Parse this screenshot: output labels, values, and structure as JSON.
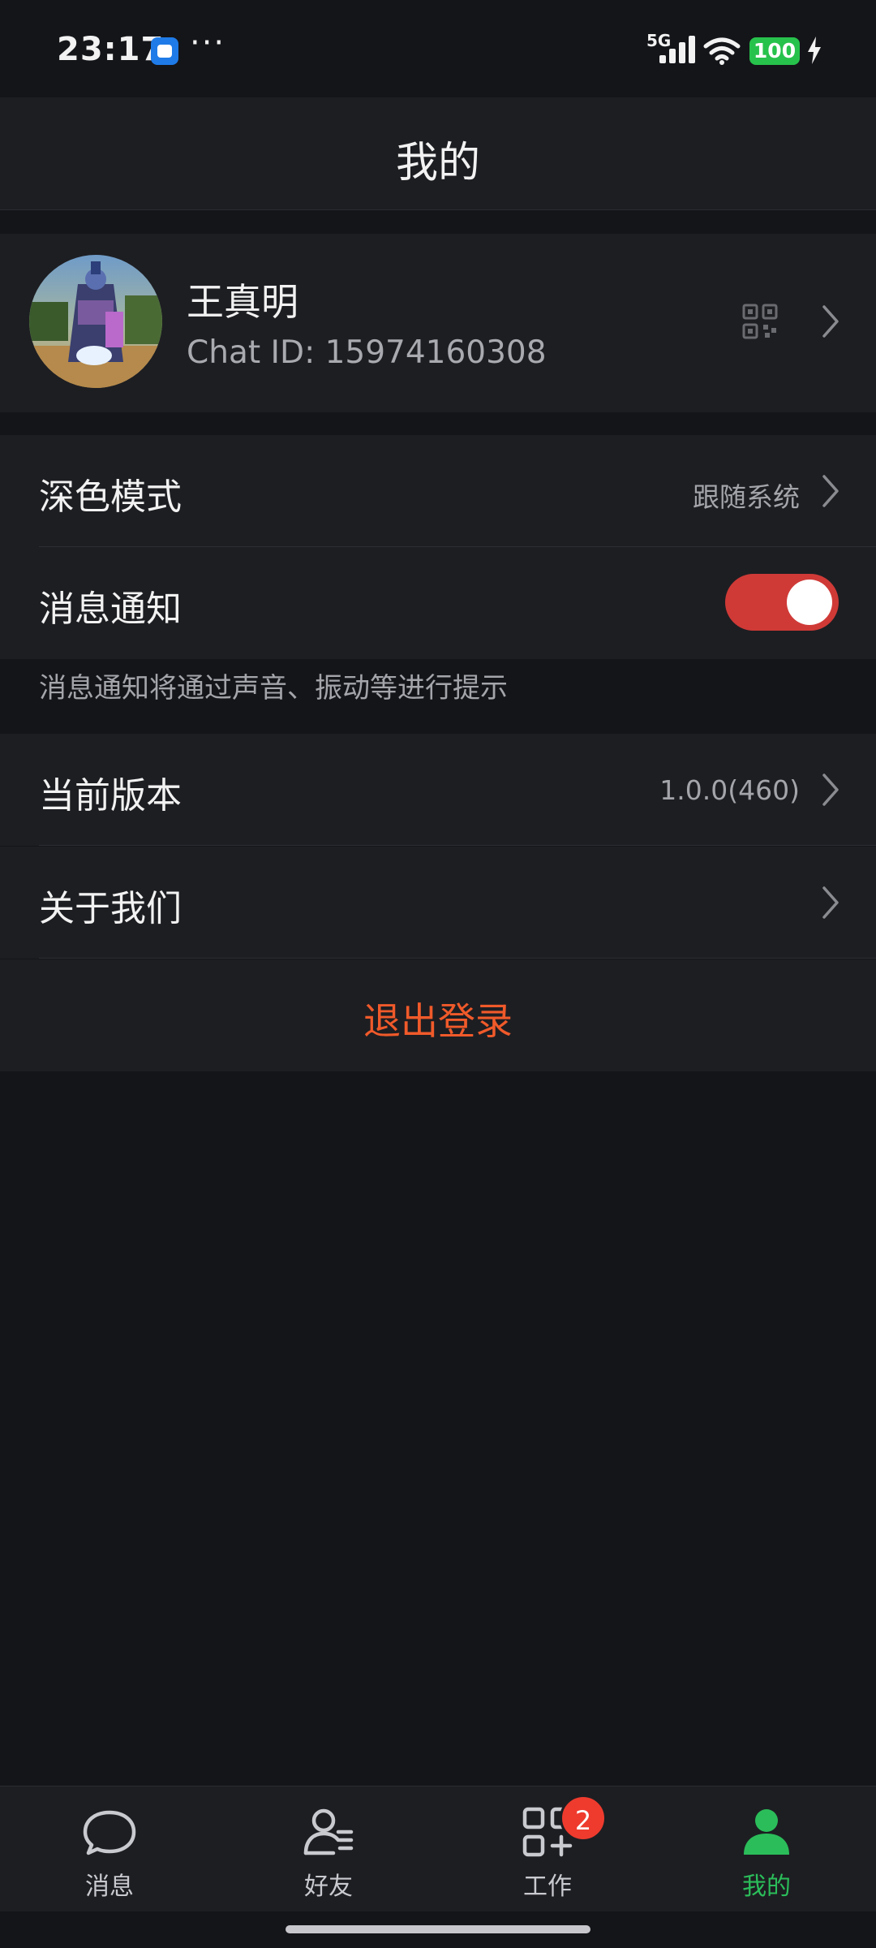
{
  "status_bar": {
    "time": "23:17",
    "dots": "···",
    "network": "5G",
    "battery": "100"
  },
  "header": {
    "title": "我的"
  },
  "profile": {
    "name": "王真明",
    "chat_id": "Chat ID: 15974160308"
  },
  "settings": {
    "dark_mode": {
      "label": "深色模式",
      "value": "跟随系统"
    },
    "notifications": {
      "label": "消息通知",
      "enabled": true,
      "hint": "消息通知将通过声音、振动等进行提示"
    },
    "version": {
      "label": "当前版本",
      "value": "1.0.0(460)"
    },
    "about": {
      "label": "关于我们"
    },
    "logout_label": "退出登录"
  },
  "bottom_nav": {
    "items": [
      {
        "label": "消息",
        "icon": "chat-bubble-icon",
        "active": false
      },
      {
        "label": "好友",
        "icon": "contacts-icon",
        "active": false
      },
      {
        "label": "工作",
        "icon": "apps-grid-icon",
        "active": false,
        "badge": "2"
      },
      {
        "label": "我的",
        "icon": "person-icon",
        "active": true
      }
    ]
  },
  "colors": {
    "background": "#141519",
    "surface": "#1d1e22",
    "accent_green": "#2bbd5a",
    "toggle_red": "#cf3a37",
    "logout_orange": "#f05a2a",
    "badge_red": "#ee3b2e"
  }
}
